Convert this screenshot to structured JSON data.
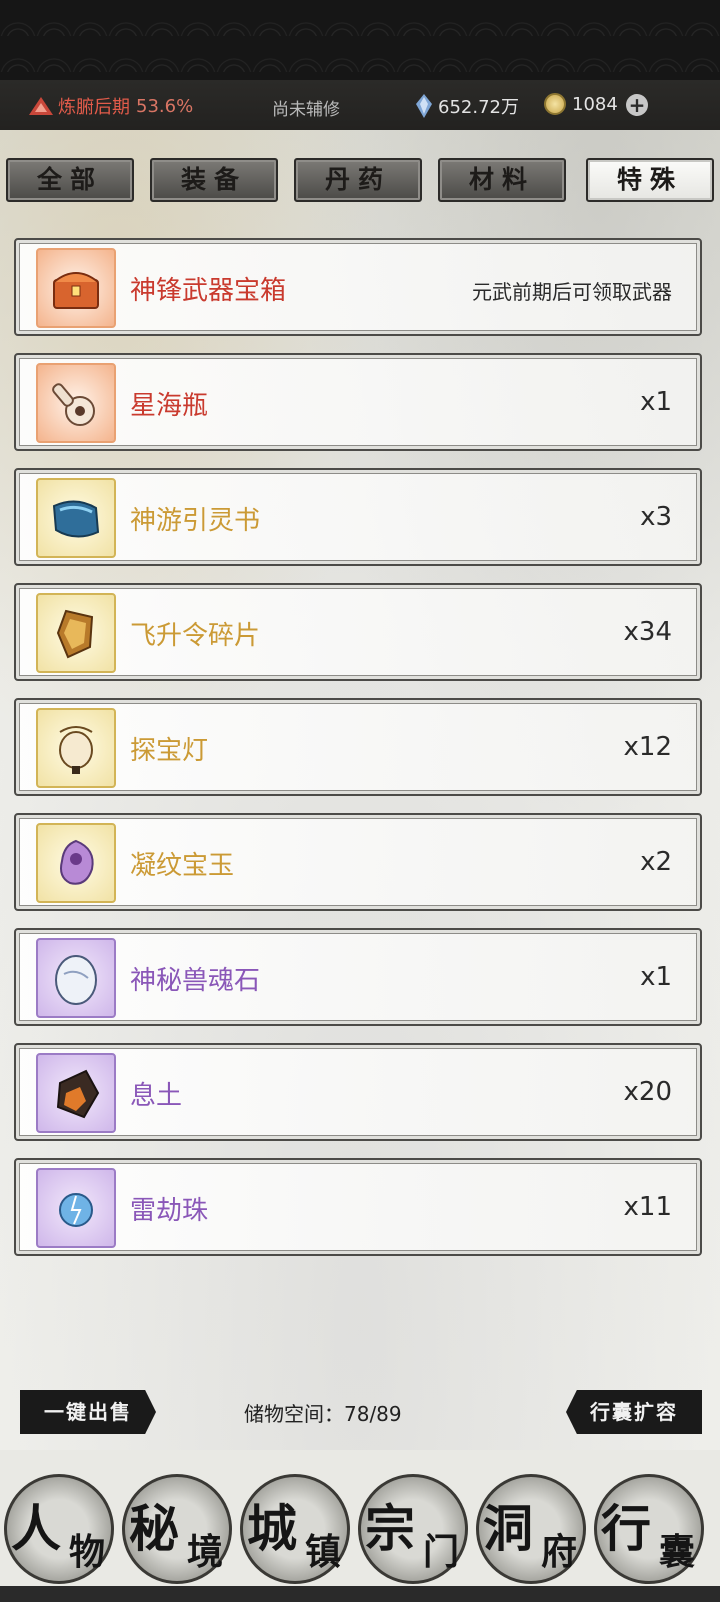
{
  "status": {
    "realm": "炼腑后期",
    "realm_percent": "53.6%",
    "assist": "尚未辅修",
    "spirit_stones": "652.72万",
    "coins": "1084",
    "plus_icon": "plus-icon"
  },
  "tabs": [
    {
      "label": "全部",
      "active": false
    },
    {
      "label": "装备",
      "active": false
    },
    {
      "label": "丹药",
      "active": false
    },
    {
      "label": "材料",
      "active": false
    },
    {
      "label": "特殊",
      "active": true
    }
  ],
  "items": [
    {
      "name": "神锋武器宝箱",
      "note": "元武前期后可领取武器",
      "rarity": "red",
      "icon": "treasure-chest-icon"
    },
    {
      "name": "星海瓶",
      "qty": "x1",
      "rarity": "red",
      "icon": "bottle-icon"
    },
    {
      "name": "神游引灵书",
      "qty": "x3",
      "rarity": "yellow",
      "icon": "scroll-icon"
    },
    {
      "name": "飞升令碎片",
      "qty": "x34",
      "rarity": "yellow",
      "icon": "token-shard-icon"
    },
    {
      "name": "探宝灯",
      "qty": "x12",
      "rarity": "yellow",
      "icon": "lantern-icon"
    },
    {
      "name": "凝纹宝玉",
      "qty": "x2",
      "rarity": "yellow",
      "icon": "jade-icon"
    },
    {
      "name": "神秘兽魂石",
      "qty": "x1",
      "rarity": "purple",
      "icon": "soul-stone-icon"
    },
    {
      "name": "息土",
      "qty": "x20",
      "rarity": "purple",
      "icon": "soil-icon"
    },
    {
      "name": "雷劫珠",
      "qty": "x11",
      "rarity": "purple",
      "icon": "thunder-pearl-icon"
    }
  ],
  "bottom": {
    "sell_all": "一键出售",
    "storage": "储物空间：78/89",
    "expand": "行囊扩容"
  },
  "nav": [
    {
      "big": "人",
      "small": "物"
    },
    {
      "big": "秘",
      "small": "境"
    },
    {
      "big": "城",
      "small": "镇"
    },
    {
      "big": "宗",
      "small": "门"
    },
    {
      "big": "洞",
      "small": "府"
    },
    {
      "big": "行",
      "small": "囊"
    }
  ],
  "colors": {
    "red": "#c93a2e",
    "yellow": "#cb9a35",
    "purple": "#8a57b8"
  }
}
